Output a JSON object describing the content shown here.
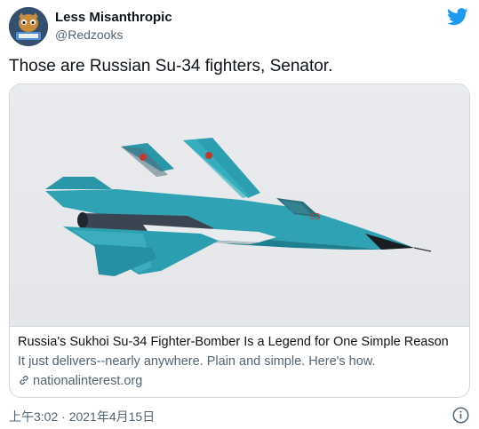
{
  "user": {
    "display_name": "Less Misanthropic",
    "handle": "@Redzooks"
  },
  "tweet": {
    "text": "Those are Russian Su-34 fighters, Senator."
  },
  "card": {
    "title": "Russia's Sukhoi Su-34 Fighter-Bomber Is a Legend for One Simple Reason",
    "description": "It just delivers--nearly anywhere. Plain and simple. Here's how.",
    "domain": "nationalinterest.org"
  },
  "meta": {
    "timestamp": "上午3:02 · 2021年4月15日"
  },
  "icons": {
    "brand": "twitter-bird-icon",
    "info": "info-icon",
    "link": "link-icon"
  },
  "colors": {
    "brand": "#1d9bf0",
    "text_primary": "#0f1419",
    "text_secondary": "#536471",
    "border": "#cfd9de",
    "jet_body": "#2fa3b3"
  }
}
